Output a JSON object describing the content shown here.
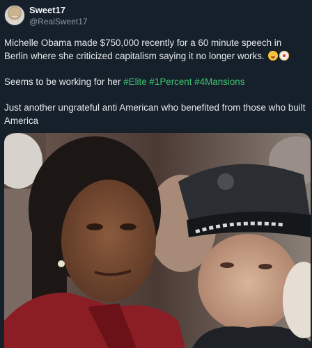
{
  "author": {
    "display_name": "Sweet17",
    "handle": "@RealSweet17"
  },
  "tweet": {
    "paragraph_1": "Michelle Obama made $750,000 recently for a 60 minute speech in Berlin where she criticized capitalism saying it no longer works.",
    "paragraph_2_text": "Seems to be working for her ",
    "hashtags": [
      "#Elite",
      "#1Percent",
      "#4Mansions"
    ],
    "paragraph_3": "Just another ungrateful anti American who benefited from those who built America"
  },
  "icons": {
    "emoji_1": "winking-tongue-face-emoji",
    "emoji_2": "clown-face-emoji"
  },
  "colors": {
    "background": "#15202b",
    "text": "#e7e9ea",
    "secondary_text": "#8b98a5",
    "hashtag": "#3fc46f"
  }
}
